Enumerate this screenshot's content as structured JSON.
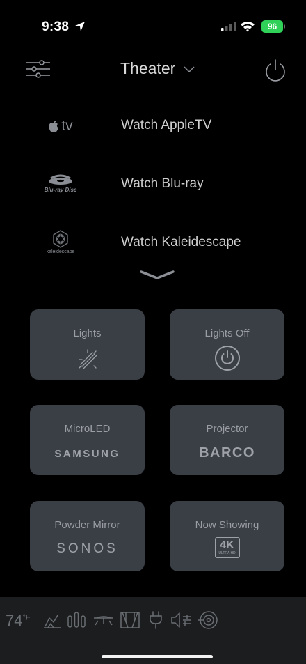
{
  "status_bar": {
    "time": "9:38",
    "battery": "96"
  },
  "header": {
    "room": "Theater",
    "icons": [
      "settings-sliders-icon",
      "chevron-down-icon",
      "power-icon"
    ]
  },
  "activities": [
    {
      "logo_text": "tv",
      "logo_icon": "apple-tv-logo",
      "label": "Watch AppleTV"
    },
    {
      "logo_text": "Blu-ray Disc",
      "logo_icon": "bluray-logo",
      "label": "Watch Blu-ray"
    },
    {
      "logo_text": "kaleidescape",
      "logo_icon": "kaleidescape-logo",
      "label": "Watch Kaleidescape"
    }
  ],
  "tiles": [
    {
      "label": "Lights",
      "icon": "lights-icon"
    },
    {
      "label": "Lights Off",
      "icon": "power-icon"
    },
    {
      "label": "MicroLED",
      "brand": "SAMSUNG"
    },
    {
      "label": "Projector",
      "brand": "BARCO"
    },
    {
      "label": "Powder Mirror",
      "brand": "SONOS"
    },
    {
      "label": "Now Showing",
      "badge": "4K",
      "badge_sub": "ULTRA HD"
    }
  ],
  "bottom_bar": {
    "temperature": "74",
    "temperature_unit": "°F",
    "icons": [
      "climate-icon",
      "shades-icon",
      "fan-icon",
      "drapes-icon",
      "outlet-icon",
      "audio-icon",
      "security-icon"
    ]
  },
  "colors": {
    "background": "#000000",
    "tile": "#3a3e45",
    "bottom_bar": "#1c1d1f",
    "battery": "#30d158"
  }
}
